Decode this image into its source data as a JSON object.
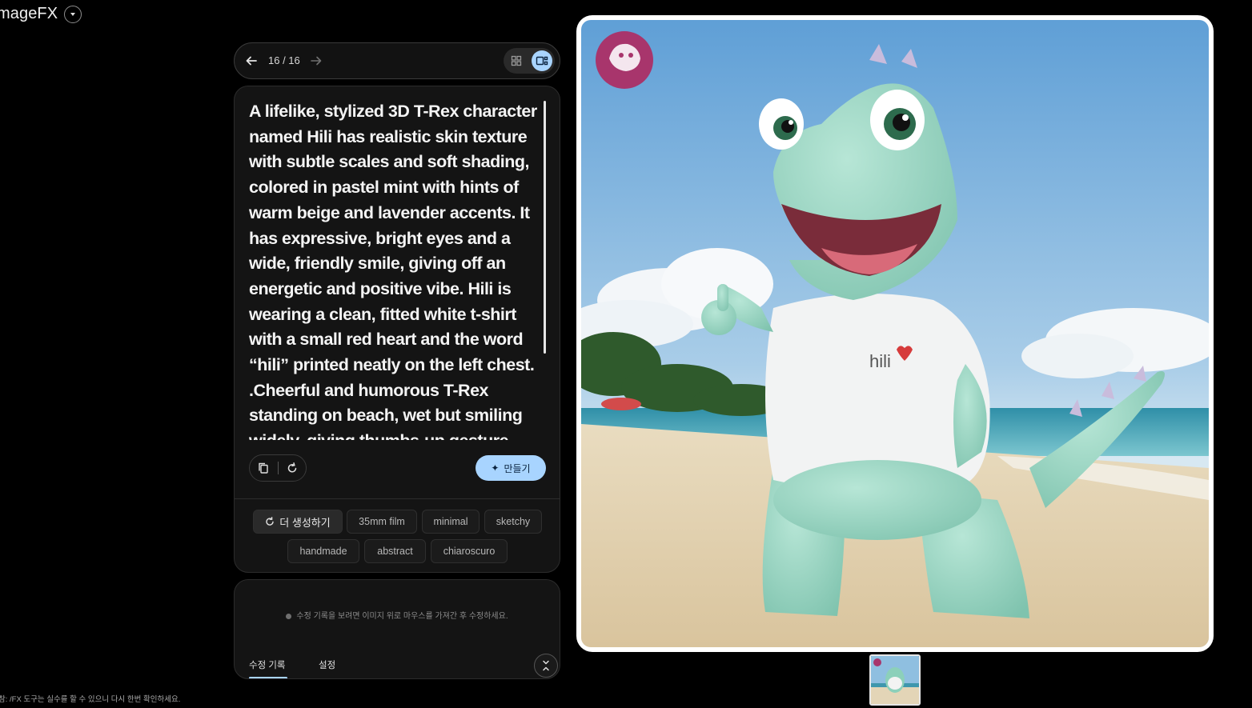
{
  "app": {
    "title": "mageFX"
  },
  "nav": {
    "counter": "16 / 16"
  },
  "prompt": {
    "text": "A lifelike, stylized 3D T-Rex character named Hili has realistic skin texture with subtle scales and soft shading, colored in pastel mint with hints of warm beige and lavender accents. It has expressive, bright eyes and a wide, friendly smile, giving off an energetic and positive vibe. Hili is wearing a clean, fitted white t-shirt with a small red heart and the word “hili” printed neatly on the left chest. .Cheerful and humorous T-Rex standing on beach, wet but smiling widely, giving thumbs-up gesture",
    "create_label": "만들기"
  },
  "chips": {
    "regenerate_label": "더 생성하기",
    "items": [
      "35mm film",
      "minimal",
      "sketchy",
      "handmade",
      "abstract",
      "chiaroscuro"
    ]
  },
  "history": {
    "hint": "수정 기록을 보려면 이미지 위로 마우스를 가져간 후 수정하세요.",
    "tabs": [
      "수정 기록",
      "설정"
    ]
  },
  "image": {
    "shirt_text": "hili"
  },
  "footer": {
    "disclaimer": "참: /FX 도구는 실수를 할 수 있으니 다시 한번 확인하세요."
  },
  "colors": {
    "accent": "#a8d4ff",
    "background": "#000000",
    "panel": "#141414"
  }
}
